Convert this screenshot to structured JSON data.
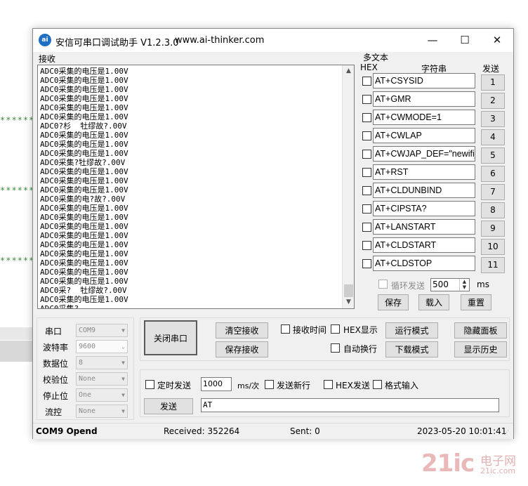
{
  "background": {
    "stars": "*******"
  },
  "window": {
    "title": "安信可串口调试助手 V1.2.3.0",
    "url": "www.ai-thinker.com",
    "icon_text": "ai",
    "controls": {
      "minimize": "—",
      "maximize": "☐",
      "close": "✕"
    }
  },
  "receive": {
    "label": "接收",
    "lines": [
      "ADC0采集的电压是1.00V",
      "ADC0采集的电压是1.00V",
      "ADC0采集的电压是1.00V",
      "ADC0采集的电压是1.00V",
      "ADC0采集的电压是1.00V",
      "ADC0采集的电压是1.00V",
      "ADC0?杉  牡缪故?.00V",
      "ADC0采集的电压是1.00V",
      "ADC0采集的电压是1.00V",
      "ADC0采集的电压是1.00V",
      "ADC0采集?牡缪故?.00V",
      "ADC0采集的电压是1.00V",
      "ADC0采集的电压是1.00V",
      "ADC0采集的电压是1.00V",
      "ADC0采集的电?故?.00V",
      "ADC0采集的电压是1.00V",
      "ADC0采集的电压是1.00V",
      "ADC0采集的电压是1.00V",
      "ADC0采集的电压是1.00V",
      "ADC0采集的电压是1.00V",
      "ADC0采集的电压是1.00V",
      "ADC0采集的电压是1.00V",
      "ADC0采集的电压是1.00V",
      "ADC0采集的电压是1.00V",
      "ADC0采?  牡缪故?.00V",
      "ADC0采集的电压是1.00V",
      "ADC0采集?"
    ]
  },
  "multitext": {
    "title": "多文本",
    "hex_header": "HEX",
    "string_header": "字符串",
    "send_header": "发送",
    "items": [
      {
        "text": "AT+CSYSID",
        "btn": "1"
      },
      {
        "text": "AT+GMR",
        "btn": "2"
      },
      {
        "text": "AT+CWMODE=1",
        "btn": "3"
      },
      {
        "text": "AT+CWLAP",
        "btn": "4"
      },
      {
        "text": "AT+CWJAP_DEF=\"newifi_",
        "btn": "5"
      },
      {
        "text": "AT+RST",
        "btn": "6"
      },
      {
        "text": "AT+CLDUNBIND",
        "btn": "7"
      },
      {
        "text": "AT+CIPSTA?",
        "btn": "8"
      },
      {
        "text": "AT+LANSTART",
        "btn": "9"
      },
      {
        "text": "AT+CLDSTART",
        "btn": "10"
      },
      {
        "text": "AT+CLDSTOP",
        "btn": "11"
      }
    ],
    "loop_send_label": "循环发送",
    "loop_interval": "500",
    "loop_unit": "ms",
    "save": "保存",
    "load": "载入",
    "reset": "重置"
  },
  "port_settings": {
    "port_label": "串口",
    "port_value": "COM9",
    "baud_label": "波特率",
    "baud_value": "9600",
    "databits_label": "数据位",
    "databits_value": "8",
    "parity_label": "校验位",
    "parity_value": "None",
    "stopbits_label": "停止位",
    "stopbits_value": "One",
    "flow_label": "流控",
    "flow_value": "None"
  },
  "controls": {
    "close_port": "关闭串口",
    "clear_receive": "清空接收",
    "save_receive": "保存接收",
    "receive_time": "接收时间",
    "hex_display": "HEX显示",
    "auto_newline": "自动换行",
    "run_mode": "运行模式",
    "download_mode": "下载模式",
    "hide_panel": "隐藏面板",
    "show_history": "显示历史"
  },
  "send": {
    "timed_send": "定时发送",
    "interval": "1000",
    "interval_unit": "ms/次",
    "send_newline": "发送新行",
    "hex_send": "HEX发送",
    "format_input": "格式输入",
    "send_button": "发送",
    "send_text": "AT"
  },
  "status": {
    "port": "COM9 Opend",
    "received": "Received: 352264",
    "sent": "Sent: 0",
    "datetime": "2023-05-20 10:01:41"
  },
  "watermark": {
    "logo": "21ic",
    "line1": "电子网",
    "line2": "21ic.com",
    "colors": {
      "brand": "#e0a0a0"
    }
  }
}
